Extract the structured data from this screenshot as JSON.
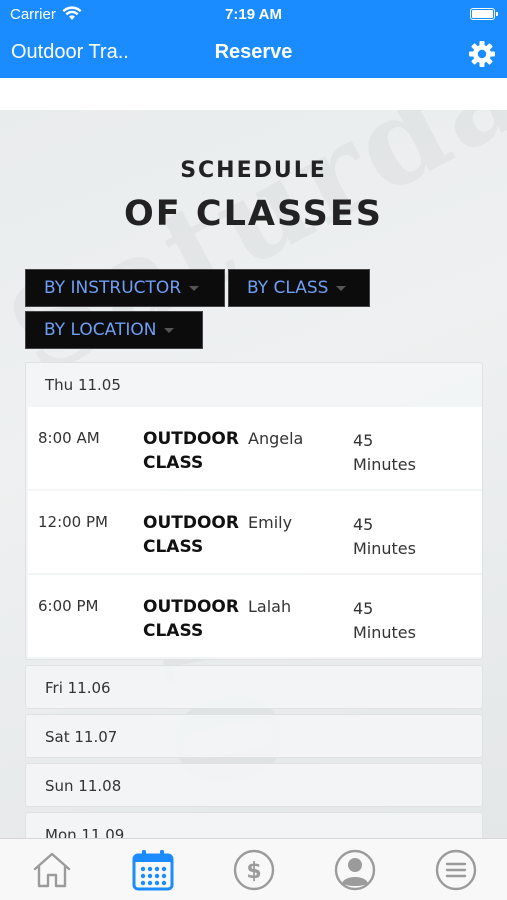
{
  "status_bar": {
    "carrier": "Carrier",
    "time": "7:19 AM"
  },
  "nav": {
    "back_title": "Outdoor Tra..",
    "title": "Reserve",
    "settings_icon": "gear-icon"
  },
  "header": {
    "line1": "SCHEDULE",
    "line2": "OF CLASSES"
  },
  "filters": {
    "by_instructor": "BY INSTRUCTOR",
    "by_class": "BY CLASS",
    "by_location": "BY LOCATION"
  },
  "schedule": {
    "days": [
      {
        "label": "Thu 11.05",
        "classes": [
          {
            "time": "8:00 AM",
            "name_line1": "OUTDOOR",
            "name_line2": "CLASS",
            "instructor": "Angela",
            "duration_value": "45",
            "duration_unit": "Minutes"
          },
          {
            "time": "12:00 PM",
            "name_line1": "OUTDOOR",
            "name_line2": "CLASS",
            "instructor": "Emily",
            "duration_value": "45",
            "duration_unit": "Minutes"
          },
          {
            "time": "6:00 PM",
            "name_line1": "OUTDOOR",
            "name_line2": "CLASS",
            "instructor": "Lalah",
            "duration_value": "45",
            "duration_unit": "Minutes"
          }
        ]
      },
      {
        "label": "Fri 11.06"
      },
      {
        "label": "Sat 11.07"
      },
      {
        "label": "Sun 11.08"
      },
      {
        "label": "Mon 11.09"
      }
    ]
  },
  "tab_bar": {
    "active_color": "#1a8cff",
    "inactive_color": "#9b9b9b",
    "tabs": [
      {
        "icon": "home-icon",
        "active": false
      },
      {
        "icon": "calendar-icon",
        "active": true
      },
      {
        "icon": "dollar-icon",
        "active": false
      },
      {
        "icon": "profile-icon",
        "active": false
      },
      {
        "icon": "menu-icon",
        "active": false
      }
    ]
  }
}
